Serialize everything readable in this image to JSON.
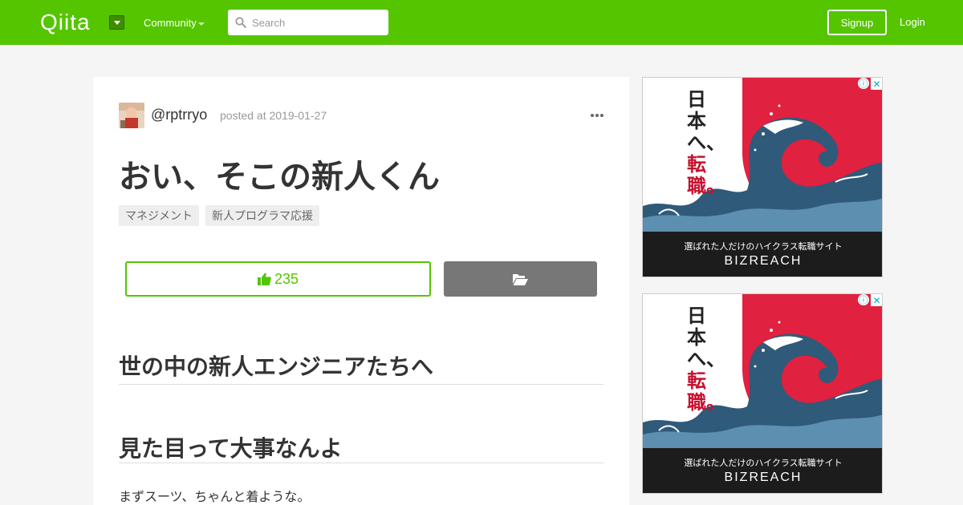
{
  "header": {
    "logo": "Qiita",
    "community_label": "Community",
    "search_placeholder": "Search",
    "signup_label": "Signup",
    "login_label": "Login"
  },
  "article": {
    "username": "@rptrryo",
    "posted": "posted at 2019-01-27",
    "title": "おい、そこの新人くん",
    "tags": [
      "マネジメント",
      "新人プログラマ応援"
    ],
    "likes": "235",
    "sections": [
      "世の中の新人エンジニアたちへ",
      "見た目って大事なんよ"
    ],
    "paragraph": "まずスーツ、ちゃんと着ような。"
  },
  "ads": {
    "copy_line1": "日本へ、",
    "copy_line2": "転職。",
    "tagline": "選ばれた人だけのハイクラス転職サイト",
    "brand": "BIZREACH",
    "info_glyph": "ⓘ",
    "close_glyph": "✕"
  },
  "colors": {
    "brand_green": "#55c500",
    "ad_red": "#e0213f"
  }
}
